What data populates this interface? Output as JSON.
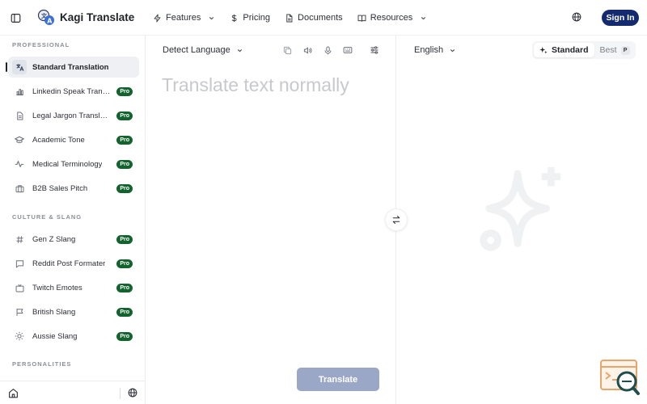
{
  "app": {
    "name": "Kagi Translate"
  },
  "nav": {
    "items": [
      {
        "label": "Features",
        "icon": "zap-icon",
        "has_dropdown": true
      },
      {
        "label": "Pricing",
        "icon": "dollar-icon",
        "has_dropdown": false
      },
      {
        "label": "Documents",
        "icon": "document-icon",
        "has_dropdown": false
      },
      {
        "label": "Resources",
        "icon": "book-icon",
        "has_dropdown": true
      }
    ],
    "signin_label": "Sign In"
  },
  "sidebar": {
    "sections": [
      {
        "title": "PROFESSIONAL",
        "items": [
          {
            "label": "Standard Translation",
            "icon": "translate-icon",
            "active": true,
            "pro": false
          },
          {
            "label": "Linkedin Speak Translator",
            "icon": "bar-chart-icon",
            "pro": true
          },
          {
            "label": "Legal Jargon Translator",
            "icon": "file-icon",
            "pro": true
          },
          {
            "label": "Academic Tone",
            "icon": "graduation-cap-icon",
            "pro": true
          },
          {
            "label": "Medical Terminology",
            "icon": "pulse-icon",
            "pro": true
          },
          {
            "label": "B2B Sales Pitch",
            "icon": "briefcase-icon",
            "pro": true
          }
        ]
      },
      {
        "title": "CULTURE & SLANG",
        "items": [
          {
            "label": "Gen Z Slang",
            "icon": "hash-icon",
            "pro": true
          },
          {
            "label": "Reddit Post Formater",
            "icon": "message-square-icon",
            "pro": true
          },
          {
            "label": "Twitch Emotes",
            "icon": "tv-icon",
            "pro": true
          },
          {
            "label": "British Slang",
            "icon": "flag-icon",
            "pro": true
          },
          {
            "label": "Aussie Slang",
            "icon": "sun-icon",
            "pro": true
          }
        ]
      },
      {
        "title": "PERSONALITIES",
        "items": []
      }
    ],
    "pro_label": "Pro"
  },
  "source": {
    "language": "Detect Language",
    "placeholder": "Translate text normally",
    "translate_label": "Translate"
  },
  "target": {
    "language": "English",
    "modes": [
      {
        "label": "Standard",
        "active": true
      },
      {
        "label": "Best",
        "active": false,
        "badge": "P"
      }
    ]
  },
  "colors": {
    "signin_bg": "#142a6e",
    "pro_badge": "#13632f",
    "translate_btn": "#9aa7c6",
    "active_item_bg": "#eef0f3"
  }
}
